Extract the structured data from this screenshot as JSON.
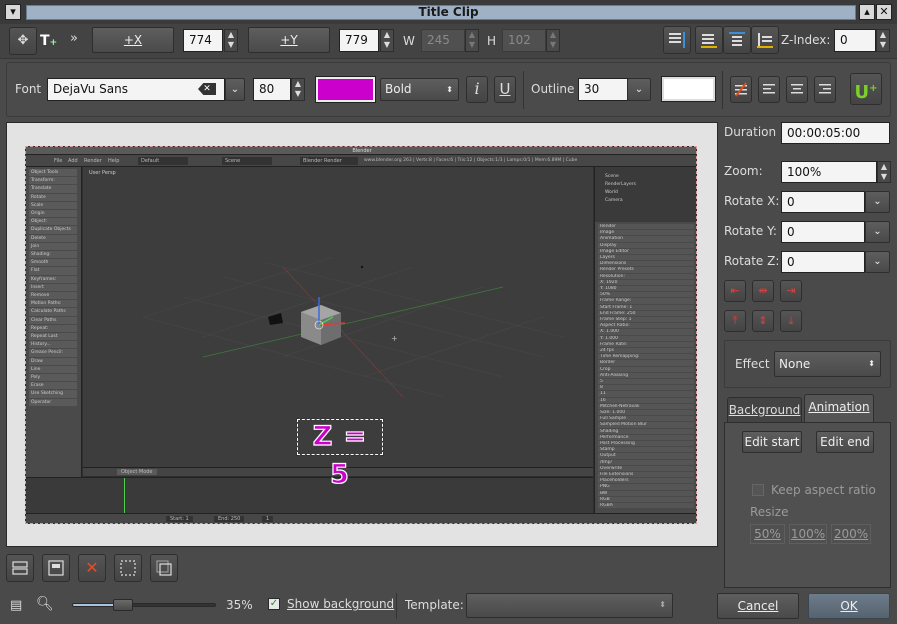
{
  "window": {
    "title": "Title Clip"
  },
  "toolbar": {
    "add_x_label": "+X",
    "x_value": "774",
    "add_y_label": "+Y",
    "y_value": "779",
    "w_label": "W",
    "w_value": "245",
    "h_label": "H",
    "h_value": "102",
    "z_index_label": "Z-Index:",
    "z_index_value": "0"
  },
  "font_bar": {
    "font_label": "Font",
    "font_value": "DejaVu Sans",
    "size_value": "80",
    "font_color": "#cc00cc",
    "weight_value": "Bold",
    "italic_label": "i",
    "underline_label": "U",
    "outline_label": "Outline",
    "outline_value": "30",
    "outline_color": "#ffffff"
  },
  "canvas": {
    "title_text": "Z = 5",
    "blender_title": "Blender",
    "blender_menu": [
      "File",
      "Add",
      "Render",
      "Help"
    ],
    "layout_name": "Default",
    "scene_name": "Scene",
    "render_engine": "Blender Render",
    "info_stats": "www.blender.org 263 | Verts:8 | Faces:6 | Tris:12 | Objects:1/3 | Lamps:0/1 | Mem:6.89M | Cube",
    "view_label": "User Persp",
    "mode_label": "Object Mode",
    "timeline": {
      "start": "Start: 1",
      "end": "End: 250",
      "frame": "1"
    },
    "left_panel": [
      "Object Tools",
      "Transform:",
      "Translate",
      "Rotate",
      "Scale",
      "Origin",
      "Object:",
      "Duplicate Objects",
      "Delete",
      "Join",
      "Shading:",
      "Smooth",
      "Flat",
      "Keyframes:",
      "Insert",
      "Remove",
      "Motion Paths:",
      "Calculate Paths",
      "Clear Paths",
      "Repeat:",
      "Repeat Last",
      "History...",
      "Grease Pencil:",
      "Draw",
      "Line",
      "Poly",
      "Erase",
      "Use Sketching",
      "Operator"
    ],
    "outliner": [
      "Scene",
      "RenderLayers",
      "World",
      "Camera"
    ],
    "properties": [
      "Render",
      "Image",
      "Animation",
      "Display",
      "Image Editor",
      "Layers",
      "Dimensions",
      "Render Presets",
      "Resolution:",
      "X: 1920",
      "Y: 1080",
      "50%",
      "Frame Range:",
      "Start Frame: 1",
      "End Frame: 250",
      "Frame Step: 1",
      "Aspect Ratio:",
      "X: 1.000",
      "Y: 1.000",
      "Frame Rate:",
      "24 fps",
      "Time Remapping:",
      "Border",
      "Crop",
      "Anti-Aliasing",
      "5",
      "8",
      "11",
      "16",
      "Mitchell-Netravali",
      "Size: 1.000",
      "Full Sample",
      "Sampled Motion Blur",
      "Shading",
      "Performance",
      "Post Processing",
      "Stamp",
      "Output",
      "/tmp/",
      "Overwrite",
      "File Extensions",
      "Placeholders",
      "PNG",
      "BW",
      "RGB",
      "RGBA"
    ]
  },
  "side": {
    "duration_label": "Duration",
    "duration_value": "00:00:05:00",
    "zoom_label": "Zoom:",
    "zoom_value": "100%",
    "rotate_x_label": "Rotate X:",
    "rotate_x_value": "0",
    "rotate_y_label": "Rotate Y:",
    "rotate_y_value": "0",
    "rotate_z_label": "Rotate Z:",
    "rotate_z_value": "0",
    "effect_label": "Effect",
    "effect_value": "None",
    "tab_background": "Background",
    "tab_animation": "Animation",
    "edit_start": "Edit start",
    "edit_end": "Edit end",
    "keep_aspect": "Keep aspect ratio",
    "resize_label": "Resize",
    "resize_50": "50%",
    "resize_100": "100%",
    "resize_200": "200%"
  },
  "bottom": {
    "zoom_percent": "35%",
    "zoom_level": 0.35,
    "show_background": "Show background",
    "template_label": "Template:",
    "template_value": "",
    "cancel": "Cancel",
    "ok": "OK"
  }
}
